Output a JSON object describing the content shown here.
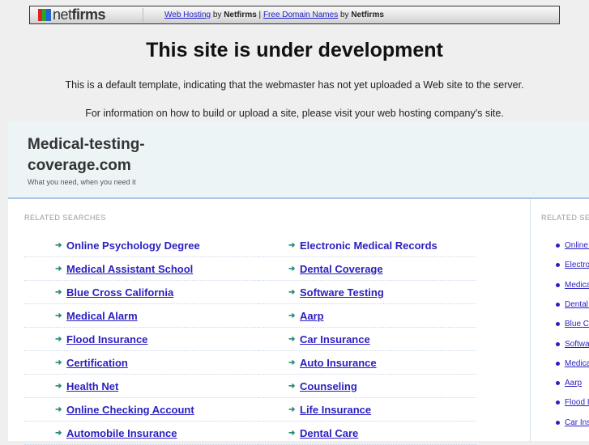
{
  "topbar": {
    "logo": "netfirms",
    "link1": "Web Hosting",
    "by1": " by ",
    "brand1": "Netfirms",
    "sep": " | ",
    "link2": "Free Domain Names",
    "by2": " by ",
    "brand2": "Netfirms"
  },
  "heading": "This site is under development",
  "msg1": "This is a default template, indicating that the webmaster has not yet uploaded a Web site to the server.",
  "msg2": "For information on how to build or upload a site, please visit your web hosting company's site.",
  "site": {
    "title": "Medical-testing-coverage.com",
    "tagline": "What you need, when you need it"
  },
  "related_label": "RELATED SEARCHES",
  "left_col": [
    "Online Psychology Degree",
    "Medical Assistant School",
    "Blue Cross California",
    "Medical Alarm",
    "Flood Insurance",
    "Certification",
    "Health Net",
    "Online Checking Account",
    "Automobile Insurance"
  ],
  "right_col": [
    "Electronic Medical Records",
    "Dental Coverage",
    "Software Testing",
    "Aarp",
    "Car Insurance",
    "Auto Insurance",
    "Counseling",
    "Life Insurance",
    "Dental Care"
  ],
  "sidebar_label": "RELATED SEARCHES",
  "sidebar": [
    "Online Psychology Degree",
    "Electronic Medical Records",
    "Medical Assistant School",
    "Dental Coverage",
    "Blue Cross California",
    "Software Testing",
    "Medical Alarm",
    "Aarp",
    "Flood Insurance",
    "Car Insurance"
  ]
}
